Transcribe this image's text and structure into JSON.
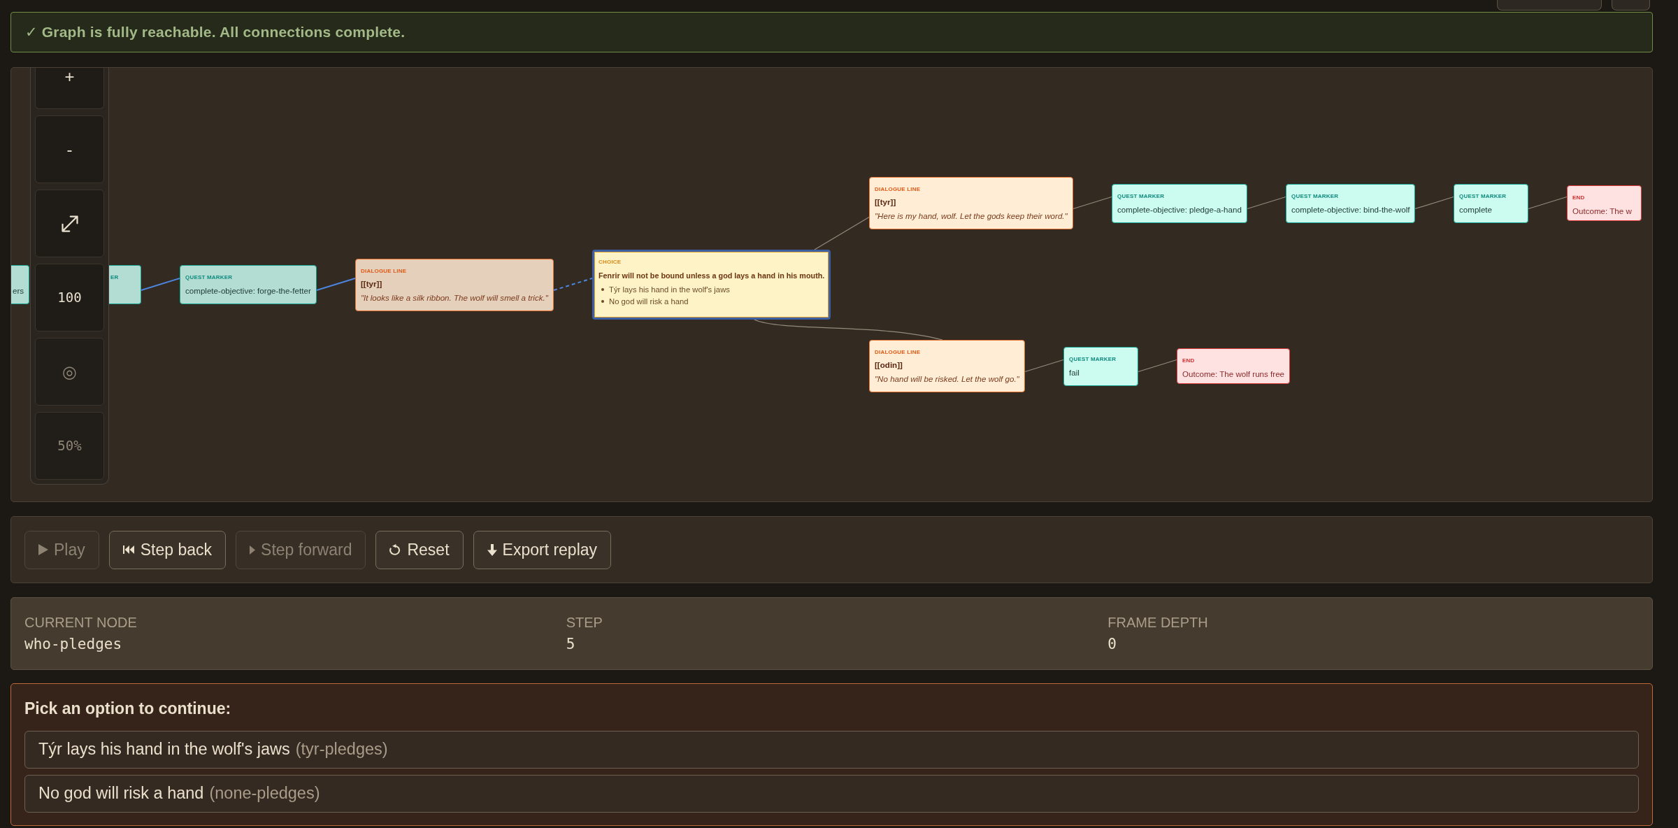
{
  "banner": {
    "kind": "success",
    "text": "✓ Graph is fully reachable. All connections complete."
  },
  "graph": {
    "zoom_controls": [
      {
        "kind": "button",
        "label": "+",
        "disabled": false
      },
      {
        "kind": "button",
        "label": "-",
        "disabled": false
      },
      {
        "kind": "fit",
        "disabled": false
      },
      {
        "kind": "readout",
        "label": "100",
        "disabled": false
      },
      {
        "kind": "button",
        "label": "◎",
        "disabled": true
      },
      {
        "kind": "readout",
        "label": "50%",
        "disabled": true
      }
    ],
    "nodes": [
      {
        "kind": "quest_marker",
        "text": "ers",
        "visited": true,
        "current": false,
        "children": [
          {
            "kind": "quest_marker",
            "label": "ER",
            "visited": true,
            "current": false,
            "children": [
              {
                "kind": "quest_marker",
                "label": "QUEST MARKER",
                "text": "complete-objective: forge-the-fetter",
                "visited": true,
                "current": false,
                "children": [
                  {
                    "kind": "dialogue_line",
                    "label": "DIALOGUE LINE",
                    "speaker": "[[tyr]]",
                    "text": "\"It looks like a silk ribbon. The wolf will smell a trick.\"",
                    "visited": true,
                    "current": false,
                    "children": [
                      {
                        "kind": "choice",
                        "label": "CHOICE",
                        "text": "Fenrir will not be bound unless a god lays a hand in his mouth.",
                        "options": [
                          "Týr lays his hand in the wolf's jaws",
                          "No god will risk a hand"
                        ],
                        "visited": false,
                        "current": true,
                        "children": [
                          {
                            "kind": "dialogue_line",
                            "label": "DIALOGUE LINE",
                            "speaker": "[[tyr]]",
                            "text": "\"Here is my hand, wolf. Let the gods keep their word.\"",
                            "visited": false,
                            "current": false,
                            "children": [
                              {
                                "kind": "quest_marker",
                                "label": "QUEST MARKER",
                                "text": "complete-objective: pledge-a-hand",
                                "visited": false,
                                "current": false,
                                "children": [
                                  {
                                    "kind": "quest_marker",
                                    "label": "QUEST MARKER",
                                    "text": "complete-objective: bind-the-wolf",
                                    "visited": false,
                                    "current": false,
                                    "children": [
                                      {
                                        "kind": "quest_marker",
                                        "label": "QUEST MARKER",
                                        "text": "complete",
                                        "visited": false,
                                        "current": false,
                                        "children": [
                                          {
                                            "kind": "end",
                                            "label": "END",
                                            "text": "Outcome: The w",
                                            "visited": false,
                                            "current": false
                                          }
                                        ]
                                      }
                                    ]
                                  }
                                ]
                              }
                            ]
                          },
                          {
                            "kind": "dialogue_line",
                            "label": "DIALOGUE LINE",
                            "speaker": "[[odin]]",
                            "text": "\"No hand will be risked. Let the wolf go.\"",
                            "visited": false,
                            "current": false,
                            "children": [
                              {
                                "kind": "quest_marker",
                                "label": "QUEST MARKER",
                                "text": "fail",
                                "visited": false,
                                "current": false,
                                "children": [
                                  {
                                    "kind": "end",
                                    "label": "END",
                                    "text": "Outcome: The wolf runs free",
                                    "visited": false,
                                    "current": false
                                  }
                                ]
                              }
                            ]
                          }
                        ]
                      }
                    ]
                  }
                ]
              }
            ]
          }
        ]
      }
    ]
  },
  "playback": {
    "buttons": [
      {
        "kind": "play",
        "label": "Play",
        "disabled": true
      },
      {
        "kind": "step_back",
        "label": "Step back",
        "disabled": false
      },
      {
        "kind": "step_forward",
        "label": "Step forward",
        "disabled": true
      },
      {
        "kind": "reset",
        "label": "Reset",
        "disabled": false
      },
      {
        "kind": "export",
        "label": "Export replay",
        "disabled": false
      }
    ]
  },
  "status": {
    "fields": [
      {
        "label": "CURRENT NODE",
        "value": "who-pledges"
      },
      {
        "label": "STEP",
        "value": "5"
      },
      {
        "label": "FRAME DEPTH",
        "value": "0"
      }
    ]
  },
  "prompt": {
    "title": "Pick an option to continue:",
    "options": [
      {
        "label": "Týr lays his hand in the wolf's jaws",
        "detail": "(tyr-pledges)"
      },
      {
        "label": "No god will risk a hand",
        "detail": "(none-pledges)"
      }
    ]
  }
}
